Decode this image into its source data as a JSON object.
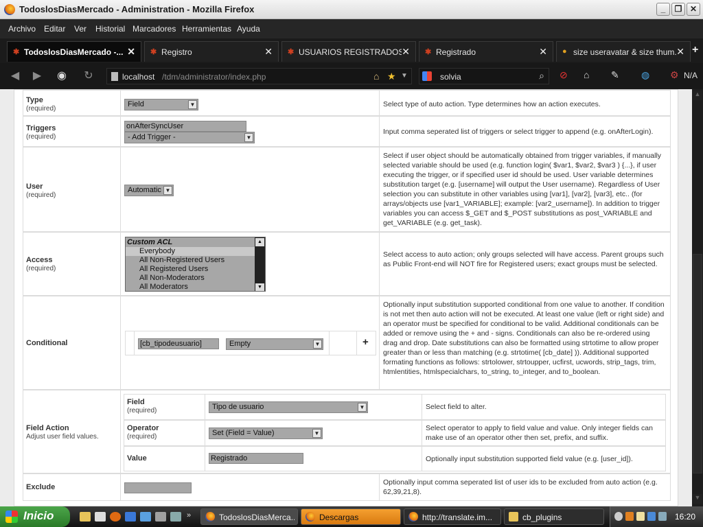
{
  "window": {
    "title": "TodoslosDiasMercado - Administration - Mozilla Firefox",
    "buttons": {
      "minimize": "_",
      "maximize": "❐",
      "close": "✕"
    }
  },
  "menu": [
    "Archivo",
    "Editar",
    "Ver",
    "Historial",
    "Marcadores",
    "Herramientas",
    "Ayuda"
  ],
  "tabs": [
    {
      "label": "TodoslosDiasMercado -...",
      "active": true
    },
    {
      "label": "Registro",
      "active": false
    },
    {
      "label": "USUARIOS REGISTRADOS (...",
      "active": false
    },
    {
      "label": "Registrado",
      "active": false
    },
    {
      "label": "size useravatar & size thum...",
      "active": false
    }
  ],
  "nav": {
    "url_host": "localhost",
    "url_path": "/tdm/administrator/index.php",
    "search_value": "solvia",
    "na_label": "N/A"
  },
  "form": {
    "type": {
      "label": "Type",
      "required": "(required)",
      "value": "Field",
      "description": "Select type of auto action. Type determines how an action executes."
    },
    "triggers": {
      "label": "Triggers",
      "required": "(required)",
      "value": "onAfterSyncUser",
      "add_option": "- Add Trigger -",
      "description": "Input comma seperated list of triggers or select trigger to append (e.g. onAfterLogin)."
    },
    "user": {
      "label": "User",
      "required": "(required)",
      "value": "Automatic",
      "description": "Select if user object should be automatically obtained from trigger variables, if manually selected variable should be used (e.g. function login( $var1, $var2, $var3 ) {...}, if user executing the trigger, or if specified user id should be used. User variable determines substitution target (e.g. [username] will output the User username). Regardless of User selection you can substitute in other variables using [var1], [var2], [var3], etc.. (for arrays/objects use [var1_VARIABLE]; example: [var2_username]). In addition to trigger variables you can access $_GET and $_POST substitutions as post_VARIABLE and get_VARIABLE (e.g. get_task)."
    },
    "access": {
      "label": "Access",
      "required": "(required)",
      "options": [
        "Custom ACL",
        "Everybody",
        "All Non-Registered Users",
        "All Registered Users",
        "All Non-Moderators",
        "All Moderators"
      ],
      "description": "Select access to auto action; only groups selected will have access. Parent groups such as Public Front-end will NOT fire for Registered users; exact groups must be selected."
    },
    "conditional": {
      "label": "Conditional",
      "field_value": "[cb_tipodeusuario]",
      "operator": "Empty",
      "plus": "+",
      "description": "Optionally input substitution supported conditional from one value to another. If condition is not met then auto action will not be executed. At least one value (left or right side) and an operator must be specified for conditional to be valid. Additional conditionals can be added or remove using the + and - signs. Conditionals can also be re-ordered using drag and drop. Date substitutions can also be formatted using strtotime to allow proper greater than or less than matching (e.g. strtotime( [cb_date] )). Additional supported formating functions as follows: strtolower, strtoupper, ucfirst, ucwords, strip_tags, trim, htmlentities, htmlspecialchars, to_string, to_integer, and to_boolean."
    },
    "field_action": {
      "label": "Field Action",
      "sublabel": "Adjust user field values.",
      "field": {
        "label": "Field",
        "required": "(required)",
        "value": "Tipo de usuario",
        "description": "Select field to alter."
      },
      "operator": {
        "label": "Operator",
        "required": "(required)",
        "value": "Set (Field = Value)",
        "description": "Select operator to apply to field value and value. Only integer fields can make use of an operator other then set, prefix, and suffix."
      },
      "value": {
        "label": "Value",
        "value": "Registrado",
        "description": "Optionally input substitution supported field value (e.g. [user_id])."
      }
    },
    "exclude": {
      "label": "Exclude",
      "value": "",
      "description": "Optionally input comma seperated list of user ids to be excluded from auto action (e.g. 62,39,21,8)."
    }
  },
  "taskbar": {
    "start": "Inicio",
    "tasks": [
      "TodoslosDiasMerca...",
      "Descargas",
      "http://translate.im...",
      "cb_plugins"
    ],
    "clock": "16:20"
  }
}
